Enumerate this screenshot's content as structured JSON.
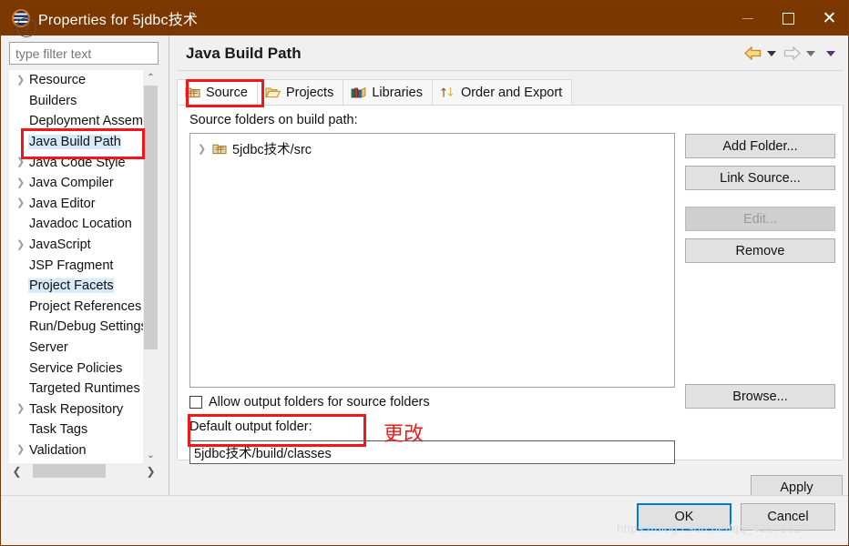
{
  "window": {
    "title": "Properties for 5jdbc技术",
    "logo_icon": "eclipse-logo-icon",
    "minimize_label": "—",
    "maximize_label": "□",
    "close_label": "✕"
  },
  "sidebar": {
    "filter": {
      "value": "",
      "placeholder": "type filter text"
    },
    "items": [
      {
        "label": "Resource",
        "expandable": true,
        "selected": false
      },
      {
        "label": "Builders",
        "expandable": false,
        "selected": false
      },
      {
        "label": "Deployment Assembly",
        "expandable": false,
        "selected": false
      },
      {
        "label": "Java Build Path",
        "expandable": false,
        "selected": true
      },
      {
        "label": "Java Code Style",
        "expandable": true,
        "selected": false
      },
      {
        "label": "Java Compiler",
        "expandable": true,
        "selected": false
      },
      {
        "label": "Java Editor",
        "expandable": true,
        "selected": false
      },
      {
        "label": "Javadoc Location",
        "expandable": false,
        "selected": false
      },
      {
        "label": "JavaScript",
        "expandable": true,
        "selected": false
      },
      {
        "label": "JSP Fragment",
        "expandable": false,
        "selected": false
      },
      {
        "label": "Project Facets",
        "expandable": false,
        "selected": true
      },
      {
        "label": "Project References",
        "expandable": false,
        "selected": false
      },
      {
        "label": "Run/Debug Settings",
        "expandable": false,
        "selected": false
      },
      {
        "label": "Server",
        "expandable": false,
        "selected": false
      },
      {
        "label": "Service Policies",
        "expandable": false,
        "selected": false
      },
      {
        "label": "Targeted Runtimes",
        "expandable": false,
        "selected": false
      },
      {
        "label": "Task Repository",
        "expandable": true,
        "selected": false
      },
      {
        "label": "Task Tags",
        "expandable": false,
        "selected": false
      },
      {
        "label": "Validation",
        "expandable": true,
        "selected": false
      }
    ],
    "scroll_up_glyph": "⌃",
    "scroll_down_glyph": "⌄",
    "scroll_left_glyph": "❮",
    "scroll_right_glyph": "❯"
  },
  "page": {
    "title": "Java Build Path",
    "nav": {
      "back_icon": "back-arrow-icon",
      "forward_icon": "forward-arrow-icon",
      "menu_icon": "chevron-down-icon"
    },
    "tabs": [
      {
        "label": "Source",
        "icon": "package-folder-icon",
        "active": true
      },
      {
        "label": "Projects",
        "icon": "open-folder-icon",
        "active": false
      },
      {
        "label": "Libraries",
        "icon": "books-icon",
        "active": false
      },
      {
        "label": "Order and Export",
        "icon": "order-arrows-icon",
        "active": false
      }
    ],
    "source_label": "Source folders on build path:",
    "source_entries": [
      {
        "label": "5jdbc技术/src",
        "icon": "package-folder-icon"
      }
    ],
    "buttons": {
      "add_folder": "Add Folder...",
      "link_source": "Link Source...",
      "edit": "Edit...",
      "remove": "Remove",
      "browse": "Browse...",
      "apply": "Apply"
    },
    "allow_output_checkbox": {
      "label": "Allow output folders for source folders",
      "checked": false
    },
    "output_label": "Default output folder:",
    "output_value": "5jdbc技术/build/classes"
  },
  "footer": {
    "help_icon": "question-mark-icon",
    "help_glyph": "?",
    "ok_label": "OK",
    "cancel_label": "Cancel",
    "watermark": "https://blog.csdn.net/qq_43676817"
  },
  "annotations": {
    "color": "#f2151a",
    "note_text": "更改"
  }
}
